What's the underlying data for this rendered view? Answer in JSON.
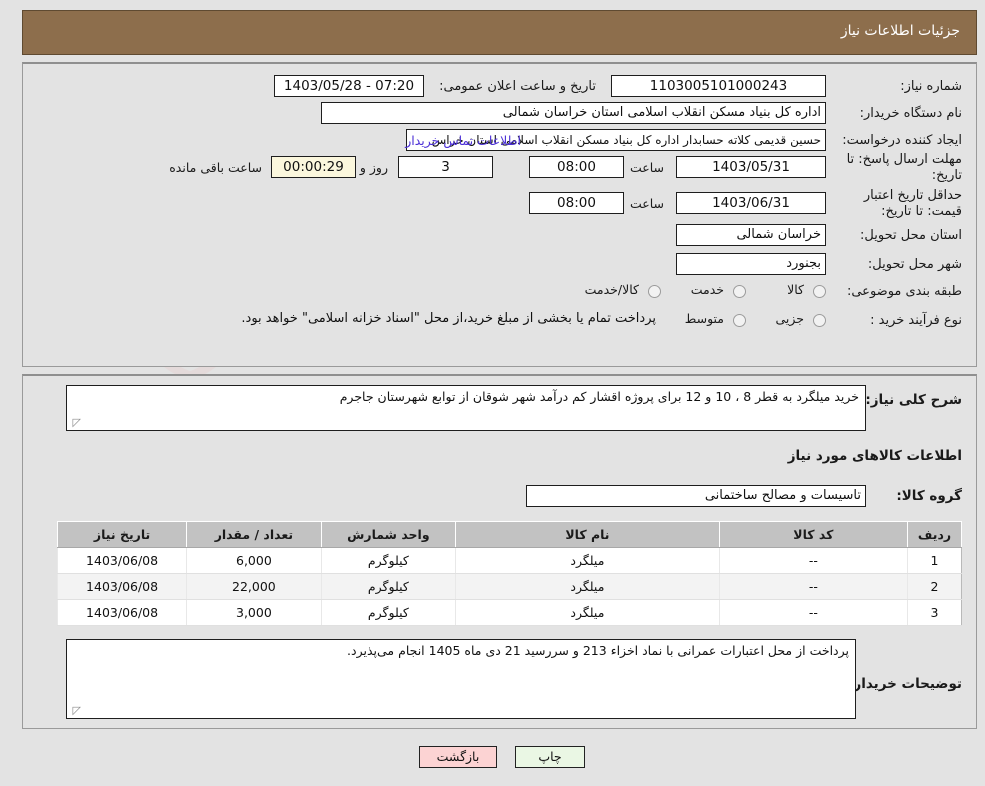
{
  "header": {
    "title": "جزئیات اطلاعات نیاز"
  },
  "form": {
    "need_number_label": "شماره نیاز:",
    "need_number_value": "1103005101000243",
    "announce_label": "تاریخ و ساعت اعلان عمومی:",
    "announce_value": "1403/05/28 - 07:20",
    "buyer_org_label": "نام دستگاه خریدار:",
    "buyer_org_value": "اداره کل بنیاد مسکن انقلاب اسلامی استان خراسان شمالی",
    "creator_label": "ایجاد کننده درخواست:",
    "creator_value": "حسین قدیمی کلاته حسابدار اداره کل بنیاد مسکن انقلاب اسلامی استان خراس",
    "contact_link": "اطلاعات تماس خریدار",
    "deadline_label": "مهلت ارسال پاسخ: تا تاریخ:",
    "deadline_date": "1403/05/31",
    "deadline_hour_label": "ساعت",
    "deadline_hour": "08:00",
    "days_value": "3",
    "days_label": "روز و",
    "countdown_value": "00:00:29",
    "countdown_label": "ساعت باقی مانده",
    "price_validity_label": "حداقل تاریخ اعتبار قیمت: تا تاریخ:",
    "price_validity_date": "1403/06/31",
    "price_validity_hour_label": "ساعت",
    "price_validity_hour": "08:00",
    "province_label": "استان محل تحویل:",
    "province_value": "خراسان شمالی",
    "city_label": "شهر محل تحویل:",
    "city_value": "بجنورد",
    "classification_label": "طبقه بندی موضوعی:",
    "classification_options": [
      "کالا",
      "خدمت",
      "کالا/خدمت"
    ],
    "process_type_label": "نوع فرآیند خرید :",
    "process_type_options": [
      "جزیی",
      "متوسط"
    ],
    "payment_note": "پرداخت تمام یا بخشی از مبلغ خرید،از محل \"اسناد خزانه اسلامی\" خواهد بود."
  },
  "detail": {
    "summary_label": "شرح کلی نیاز:",
    "summary_value": "خرید میلگرد به قطر 8 ، 10 و 12 برای پروژه اقشار کم درآمد شهر شوقان از توابع شهرستان جاجرم",
    "goods_heading": "اطلاعات کالاهای مورد نیاز",
    "group_label": "گروه کالا:",
    "group_value": "تاسیسات و مصالح ساختمانی",
    "buyer_notes_label": "توضیحات خریدار:",
    "buyer_notes_value": "پرداخت از محل اعتبارات عمرانی با نماد اخزاء 213 و سررسید 21 دی ماه 1405 انجام می‌پذیرد."
  },
  "table": {
    "columns": [
      "ردیف",
      "کد کالا",
      "نام کالا",
      "واحد شمارش",
      "تعداد / مقدار",
      "تاریخ نیاز"
    ],
    "rows": [
      {
        "row": "1",
        "code": "--",
        "name": "میلگرد",
        "unit": "کیلوگرم",
        "qty": "6,000",
        "date": "1403/06/08"
      },
      {
        "row": "2",
        "code": "--",
        "name": "میلگرد",
        "unit": "کیلوگرم",
        "qty": "22,000",
        "date": "1403/06/08"
      },
      {
        "row": "3",
        "code": "--",
        "name": "میلگرد",
        "unit": "کیلوگرم",
        "qty": "3,000",
        "date": "1403/06/08"
      }
    ]
  },
  "footer": {
    "back_label": "بازگشت",
    "print_label": "چاپ"
  },
  "watermark": {
    "text": "AriaTender.net"
  },
  "colors": {
    "header_bg": "#8d6e4c",
    "page_bg": "#e3e3e3",
    "link": "#4b2fd6",
    "back_btn": "#fcd3d3",
    "print_btn": "#eaf7e4",
    "countdown_bg": "#fbf7dd",
    "table_header": "#c2c2c2"
  }
}
